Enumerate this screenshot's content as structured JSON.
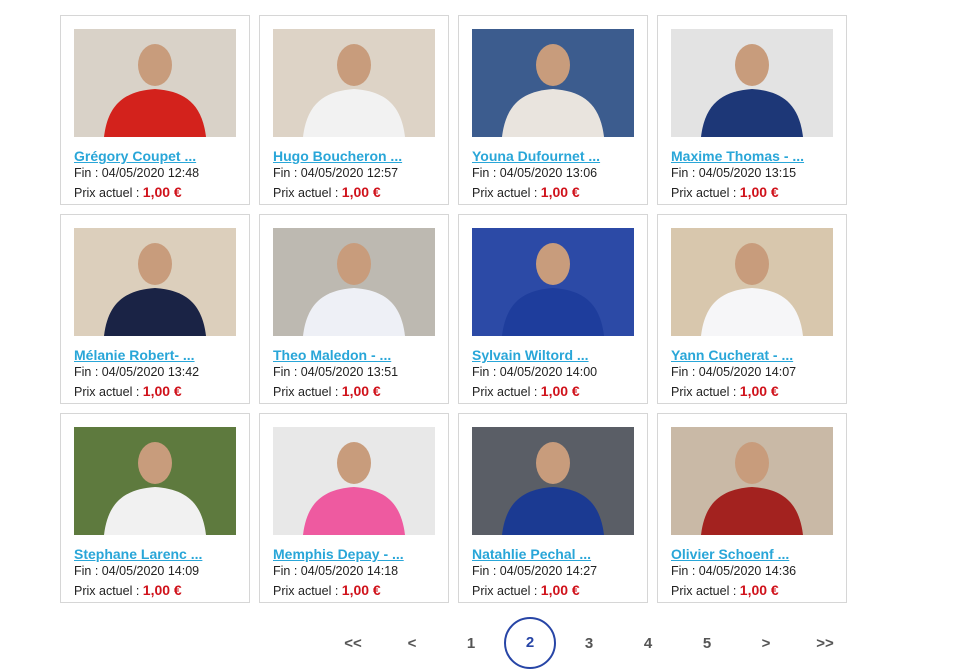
{
  "items": [
    {
      "title": "Grégory Coupet  ...",
      "end_label": "Fin :",
      "end": "04/05/2020 12:48",
      "price_label": "Prix actuel :",
      "price": "1,00 €",
      "bg": "#d9d2c8",
      "fg": "#d3221c"
    },
    {
      "title": "Hugo Boucheron  ...",
      "end_label": "Fin :",
      "end": "04/05/2020 12:57",
      "price_label": "Prix actuel :",
      "price": "1,00 €",
      "bg": "#ddd3c6",
      "fg": "#f2f2f2"
    },
    {
      "title": "Youna Dufournet ...",
      "end_label": "Fin :",
      "end": "04/05/2020 13:06",
      "price_label": "Prix actuel :",
      "price": "1,00 €",
      "bg": "#3c5c8e",
      "fg": "#e9e4de"
    },
    {
      "title": "Maxime Thomas - ...",
      "end_label": "Fin :",
      "end": "04/05/2020 13:15",
      "price_label": "Prix actuel :",
      "price": "1,00 €",
      "bg": "#e3e3e3",
      "fg": "#1d3777"
    },
    {
      "title": "Mélanie Robert- ...",
      "end_label": "Fin :",
      "end": "04/05/2020 13:42",
      "price_label": "Prix actuel :",
      "price": "1,00 €",
      "bg": "#dccfbc",
      "fg": "#1a2345"
    },
    {
      "title": "Theo Maledon -  ...",
      "end_label": "Fin :",
      "end": "04/05/2020 13:51",
      "price_label": "Prix actuel :",
      "price": "1,00 €",
      "bg": "#bdb9b1",
      "fg": "#eef0f6"
    },
    {
      "title": "Sylvain Wiltord ...",
      "end_label": "Fin :",
      "end": "04/05/2020 14:00",
      "price_label": "Prix actuel :",
      "price": "1,00 €",
      "bg": "#2c4aa6",
      "fg": "#1e3d9c"
    },
    {
      "title": "Yann Cucherat - ...",
      "end_label": "Fin :",
      "end": "04/05/2020 14:07",
      "price_label": "Prix actuel :",
      "price": "1,00 €",
      "bg": "#d8c7ad",
      "fg": "#f6f6f8"
    },
    {
      "title": "Stephane Larenc ...",
      "end_label": "Fin :",
      "end": "04/05/2020 14:09",
      "price_label": "Prix actuel :",
      "price": "1,00 €",
      "bg": "#5e7a3e",
      "fg": "#f1f1f1"
    },
    {
      "title": "Memphis Depay - ...",
      "end_label": "Fin :",
      "end": "04/05/2020 14:18",
      "price_label": "Prix actuel :",
      "price": "1,00 €",
      "bg": "#e8e8e8",
      "fg": "#ee5aa0"
    },
    {
      "title": "Natahlie Pechal ...",
      "end_label": "Fin :",
      "end": "04/05/2020 14:27",
      "price_label": "Prix actuel :",
      "price": "1,00 €",
      "bg": "#5a5e66",
      "fg": "#1b3a92"
    },
    {
      "title": "Olivier Schoenf ...",
      "end_label": "Fin :",
      "end": "04/05/2020 14:36",
      "price_label": "Prix actuel :",
      "price": "1,00 €",
      "bg": "#c9b9a6",
      "fg": "#a3221f"
    }
  ],
  "pagination": {
    "first": "<<",
    "prev": "<",
    "pages": [
      "1",
      "2",
      "3",
      "4",
      "5"
    ],
    "current": "2",
    "next": ">",
    "last": ">>"
  },
  "colors": {
    "link": "#29a6d8",
    "price": "#d0121b",
    "active_page": "#2745a6"
  }
}
